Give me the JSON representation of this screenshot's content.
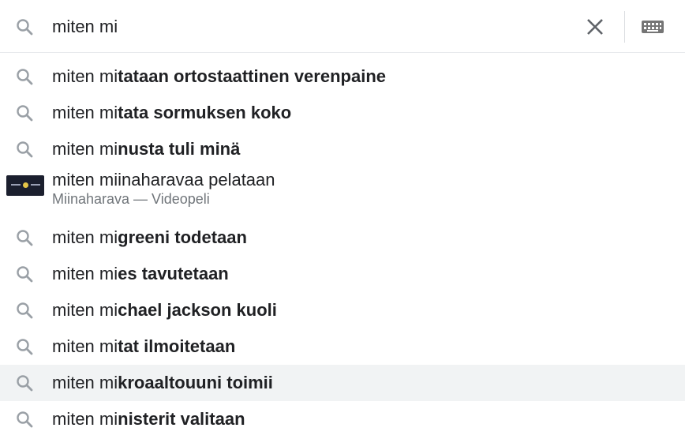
{
  "search": {
    "query": "miten mi",
    "colors": {
      "icon": "#9aa0a6",
      "text": "#202124",
      "secondary_text": "#70757a",
      "selected_row": "#f1f3f4",
      "border": "#e8eaed"
    },
    "icons": {
      "search": "search-icon",
      "clear": "close-icon",
      "keyboard": "keyboard-icon"
    }
  },
  "suggestions": [
    {
      "prefix": "miten mi",
      "completion": "tataan ortostaattinen verenpaine"
    },
    {
      "prefix": "miten mi",
      "completion": "tata sormuksen koko"
    },
    {
      "prefix": "miten mi",
      "completion": "nusta tuli minä"
    },
    {
      "title": "miten miinaharavaa pelataan",
      "subtitle": "Miinaharava — Videopeli",
      "thumbnail": "minesweeper-thumbnail"
    },
    {
      "prefix": "miten mi",
      "completion": "greeni todetaan"
    },
    {
      "prefix": "miten mi",
      "completion": "es tavutetaan"
    },
    {
      "prefix": "miten mi",
      "completion": "chael jackson kuoli"
    },
    {
      "prefix": "miten mi",
      "completion": "tat ilmoitetaan"
    },
    {
      "prefix": "miten mi",
      "completion": "kroaaltouuni toimii",
      "selected": true
    },
    {
      "prefix": "miten mi",
      "completion": "nisterit valitaan"
    }
  ]
}
